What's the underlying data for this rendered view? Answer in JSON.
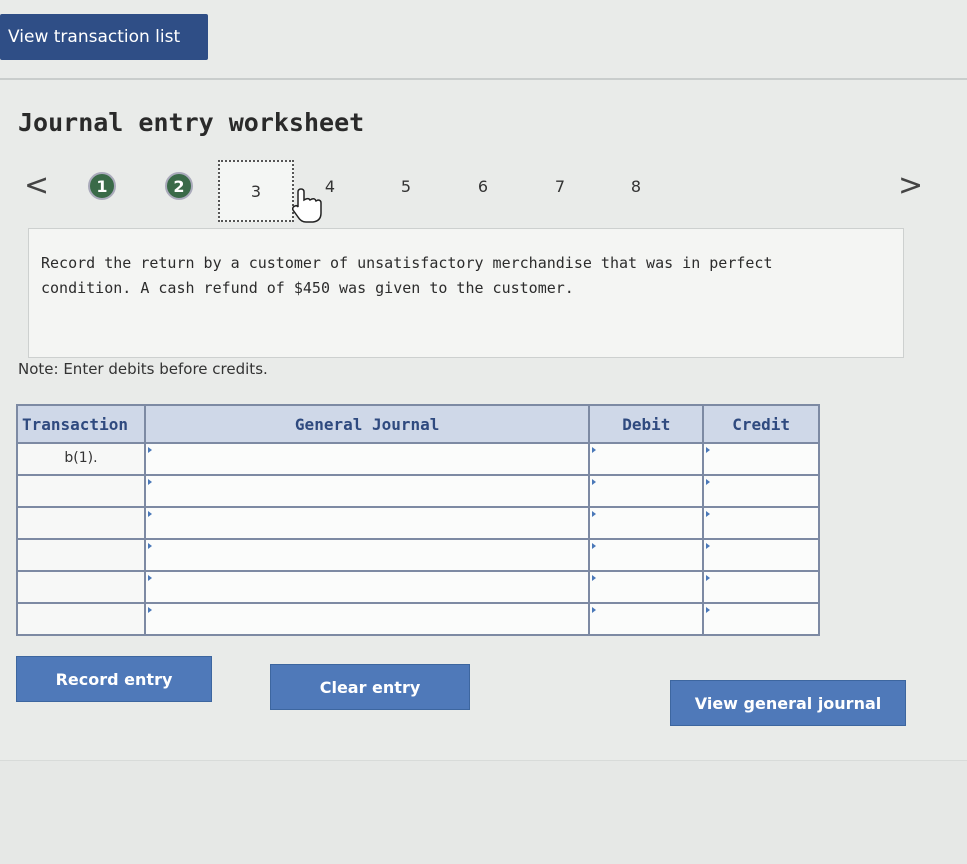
{
  "top": {
    "view_transaction_list": "View transaction list"
  },
  "page_title": "Journal entry worksheet",
  "nav": {
    "prev": "<",
    "next": ">",
    "steps": [
      {
        "label": "1",
        "state": "done"
      },
      {
        "label": "2",
        "state": "done"
      },
      {
        "label": "3",
        "state": "current"
      },
      {
        "label": "4",
        "state": "upcoming"
      },
      {
        "label": "5",
        "state": "upcoming"
      },
      {
        "label": "6",
        "state": "upcoming"
      },
      {
        "label": "7",
        "state": "upcoming"
      },
      {
        "label": "8",
        "state": "upcoming"
      }
    ]
  },
  "prompt": "Record the return by a customer of unsatisfactory merchandise that was in perfect condition. A cash refund of $450 was given to the customer.",
  "note": "Note: Enter debits before credits.",
  "journal": {
    "headers": {
      "transaction": "Transaction",
      "general_journal": "General Journal",
      "debit": "Debit",
      "credit": "Credit"
    },
    "rows": [
      {
        "transaction": "b(1).",
        "account": "",
        "debit": "",
        "credit": ""
      },
      {
        "transaction": "",
        "account": "",
        "debit": "",
        "credit": ""
      },
      {
        "transaction": "",
        "account": "",
        "debit": "",
        "credit": ""
      },
      {
        "transaction": "",
        "account": "",
        "debit": "",
        "credit": ""
      },
      {
        "transaction": "",
        "account": "",
        "debit": "",
        "credit": ""
      },
      {
        "transaction": "",
        "account": "",
        "debit": "",
        "credit": ""
      }
    ]
  },
  "buttons": {
    "record_entry": "Record entry",
    "clear_entry": "Clear entry",
    "view_general_journal": "View general journal"
  },
  "colors": {
    "primary_button": "#4f79b9",
    "header_button": "#2f4e86",
    "completed_step": "#3a6a48"
  }
}
